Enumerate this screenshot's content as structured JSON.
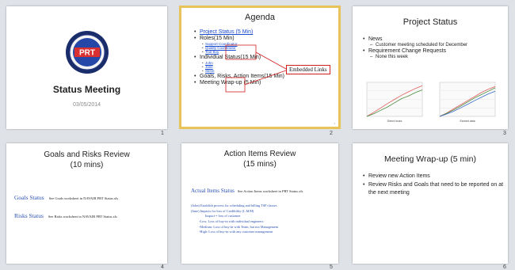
{
  "slide_numbers": [
    "1",
    "2",
    "3",
    "4",
    "5",
    "6"
  ],
  "s1": {
    "title": "Status Meeting",
    "date": "03/05/2014",
    "logo_text": "PRT"
  },
  "s2": {
    "title": "Agenda",
    "items": [
      {
        "text": "Project Status (5 Min)"
      },
      {
        "text": "Roles(15 Min)",
        "subs": [
          "Support Coordinator",
          "Quality Coordinator",
          "Tool Boy"
        ]
      },
      {
        "text": "Individual Status(15 Min)",
        "subs": [
          "John",
          "Jane",
          "Steve"
        ]
      },
      {
        "text": "Goals, Risks, Action Items(15 Min)"
      },
      {
        "text": "Meeting Wrap-up (5 Min)"
      }
    ],
    "callout": "Embedded Links",
    "slide_small_num": "2"
  },
  "s3": {
    "title": "Project Status",
    "bullets": [
      {
        "text": "News",
        "subs": [
          "Customer meeting scheduled for December"
        ]
      },
      {
        "text": "Requirement Change Requests",
        "subs": [
          "None this week"
        ]
      }
    ],
    "chart_data": [
      {
        "type": "line",
        "title": "",
        "xlabel": "Direct hours",
        "ylabel": "",
        "series": [
          {
            "values": [
              0,
              12,
              25,
              38,
              50,
              62,
              72,
              82,
              90
            ]
          },
          {
            "values": [
              0,
              8,
              18,
              28,
              40,
              52,
              60,
              70,
              78
            ]
          }
        ]
      },
      {
        "type": "line",
        "title": "",
        "xlabel": "Earned data",
        "ylabel": "",
        "series": [
          {
            "values": [
              0,
              10,
              22,
              34,
              46,
              58,
              70,
              80,
              88
            ]
          },
          {
            "values": [
              0,
              9,
              19,
              30,
              42,
              54,
              64,
              74,
              84
            ]
          },
          {
            "values": [
              0,
              7,
              15,
              25,
              35,
              46,
              56,
              66,
              74
            ]
          }
        ]
      }
    ],
    "colors": {
      "line_a": "#e05c5c",
      "line_b": "#4a8a3a",
      "line_c": "#3a6acb"
    }
  },
  "s4": {
    "title_l1": "Goals and Risks Review",
    "title_l2": "(10 mins)",
    "rows": [
      {
        "label": "Goals Status",
        "note": "See Goals worksheet in NAVAIR PRT Status.xls"
      },
      {
        "label": "Risks Status",
        "note": "See Risks worksheet in NAVAIR PRT Status.xls"
      }
    ]
  },
  "s5": {
    "title_l1": "Action Items Review",
    "title_l2": "(15 mins)",
    "head_label": "Actual Items Status",
    "head_note": "See Action Items worksheet in PRT Status.xls",
    "lines": [
      "(John) Establish process for scheduling and billing TSP classes",
      "(Jane) Impacts for loss of Credibility (L:M/H)",
      "Impact = loss of customer",
      "-Low: Loss of buy-in with individual engineers",
      "-Medium: Loss of buy-in with Team, but not Management",
      "-High: Loss of buy-in with any customer management"
    ]
  },
  "s6": {
    "title": "Meeting Wrap-up (5 min)",
    "bullets": [
      "Review new Action Items",
      "Review Risks and Goals that need to be reported on at the next meeting"
    ]
  }
}
